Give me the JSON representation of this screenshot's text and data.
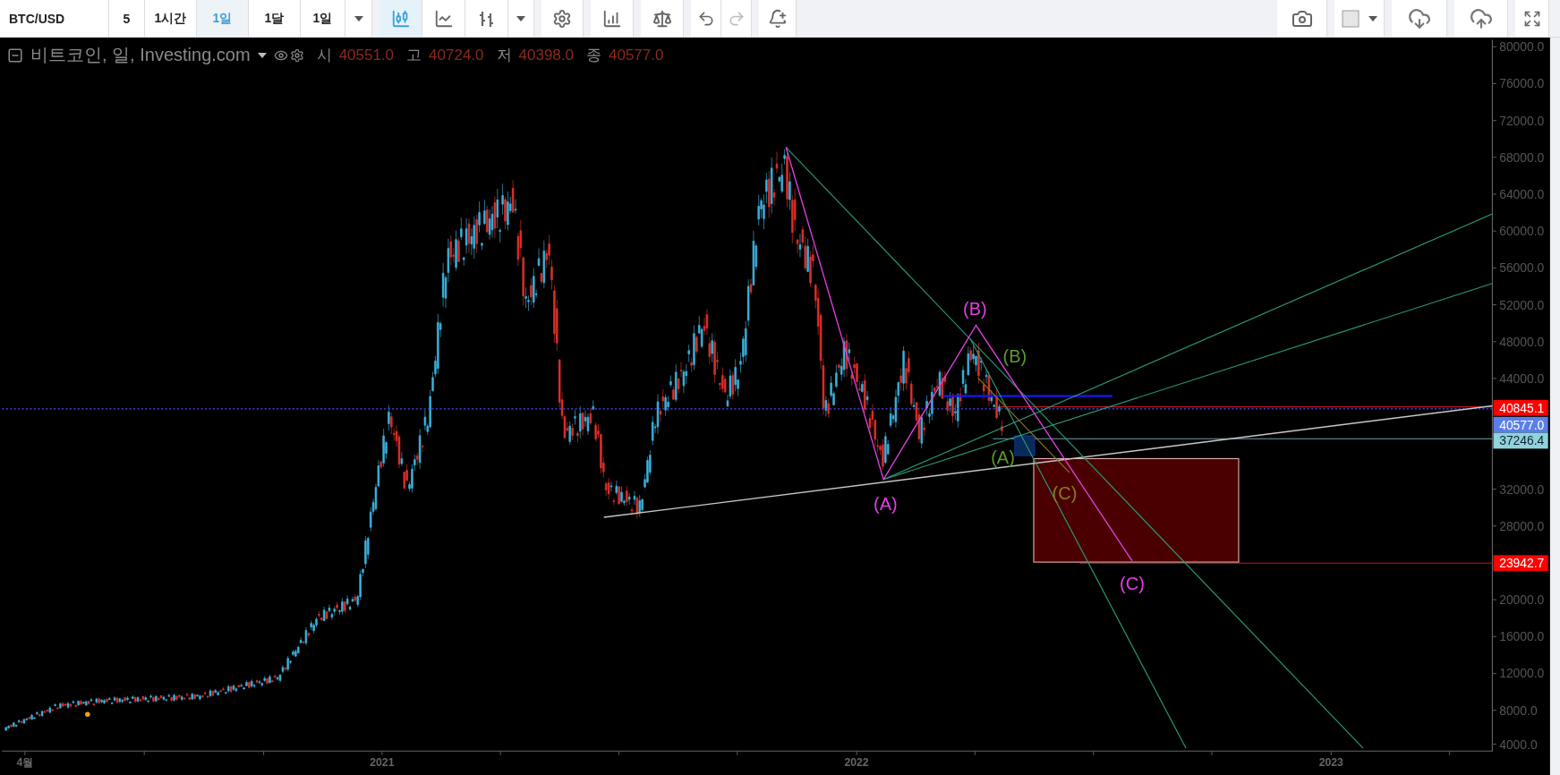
{
  "toolbar": {
    "symbol": "BTC/USD",
    "intervals": [
      {
        "label": "5",
        "selected": false
      },
      {
        "label": "1시간",
        "selected": false
      },
      {
        "label": "1일",
        "selected": true
      },
      {
        "label": "1달",
        "selected": false
      },
      {
        "label": "1일",
        "selected": false
      }
    ],
    "chart_types": [
      {
        "kind": "candles",
        "selected": true
      },
      {
        "kind": "line",
        "selected": false
      },
      {
        "kind": "bars",
        "selected": false
      }
    ]
  },
  "legend": {
    "title": "비트코인, 일, Investing.com",
    "ohlc": [
      {
        "label": "시",
        "value": "40551.0"
      },
      {
        "label": "고",
        "value": "40724.0"
      },
      {
        "label": "저",
        "value": "40398.0"
      },
      {
        "label": "종",
        "value": "40577.0"
      }
    ]
  },
  "price_axis": {
    "ticks": [
      "80000.0",
      "76000.0",
      "72000.0",
      "68000.0",
      "64000.0",
      "60000.0",
      "56000.0",
      "52000.0",
      "48000.0",
      "44000.0",
      "32000.0",
      "28000.0",
      "20000.0",
      "16000.0",
      "12000.0",
      "8000.0",
      "4000.0"
    ],
    "tags": [
      {
        "text": "40845.1",
        "color": "#ff0000"
      },
      {
        "text": "40577.0",
        "color": "#5b7fe8"
      },
      {
        "text": "37246.4",
        "color": "#8fd3dc"
      },
      {
        "text": "23942.7",
        "color": "#ff0000"
      }
    ]
  },
  "time_axis": {
    "labels": [
      "4월",
      "2021",
      "2022",
      "2023"
    ]
  },
  "wave_labels": [
    {
      "text": "(B)",
      "color": "#e040e0"
    },
    {
      "text": "(A)",
      "color": "#e040e0"
    },
    {
      "text": "(C)",
      "color": "#e040e0"
    },
    {
      "text": "(B)",
      "color": "#5a9a30"
    },
    {
      "text": "(A)",
      "color": "#5a9a30"
    },
    {
      "text": "(C)",
      "color": "#8a7a20"
    }
  ]
}
